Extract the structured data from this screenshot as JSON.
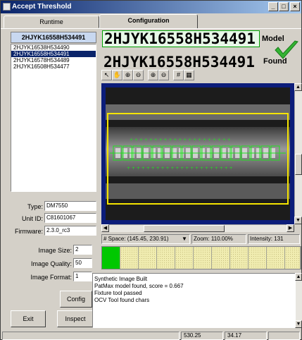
{
  "window": {
    "title": "Accept Threshold",
    "min_label": "_",
    "max_label": "□",
    "close_label": "×"
  },
  "tabs": [
    {
      "label": "Runtime"
    },
    {
      "label": "Configuration"
    }
  ],
  "serial": {
    "selected": "2HJYK16558H534491",
    "items": [
      "2HJYK16538H534490",
      "2HJYK16558H534491",
      "2HJYK16578H534489",
      "2HJYK16508H534477"
    ]
  },
  "info": {
    "type_label": "Type:",
    "type_value": "DM7550",
    "unit_label": "Unit ID:",
    "unit_value": "C81601067",
    "firmware_label": "Firmware:",
    "firmware_value": "2.3.0_rc3"
  },
  "image": {
    "size_label": "Image Size:",
    "size_value": "2",
    "quality_label": "Image Quality:",
    "quality_value": "50",
    "format_label": "Image Format:",
    "format_value": "1"
  },
  "buttons": {
    "config": "Config",
    "exit": "Exit",
    "inspect": "Inspect"
  },
  "result": {
    "model_code": "2HJYK16558H534491",
    "model_label": "Model",
    "found_code": "2HJYK16558H534491",
    "found_label": "Found",
    "status_color": "#33b333"
  },
  "toolbar": {
    "pointer": "↖",
    "pan": "✋",
    "zoom_in": "⊕",
    "zoom_out": "⊖",
    "zoom_fit": "⊕",
    "zoom_actual": "⊖",
    "grid": "#",
    "grid2": "▦"
  },
  "viewer_status": {
    "space": "# Space:  (145.45, 230.91)",
    "space_arrow": "▼",
    "zoom": "Zoom:  110.00%",
    "intensity": "Intensity:  131"
  },
  "char_cells": [
    {
      "state": "pass"
    },
    {
      "state": "pending"
    },
    {
      "state": "pending"
    },
    {
      "state": "pending"
    },
    {
      "state": "pending"
    },
    {
      "state": "pending"
    },
    {
      "state": "pending"
    },
    {
      "state": "pending"
    },
    {
      "state": "pending"
    },
    {
      "state": "pending"
    },
    {
      "state": "pending"
    }
  ],
  "log": [
    "Synthetic Image Built",
    "PatMax model found, score = 0.667",
    "Fixture tool passed",
    "OCV Tool found chars"
  ],
  "statusbar": {
    "x": "530.25",
    "y": "34.17"
  },
  "colors": {
    "viewer_bg": "#0c1d7a",
    "box": "#f5e400",
    "overlay": "#20e020",
    "pass": "#00c800"
  }
}
